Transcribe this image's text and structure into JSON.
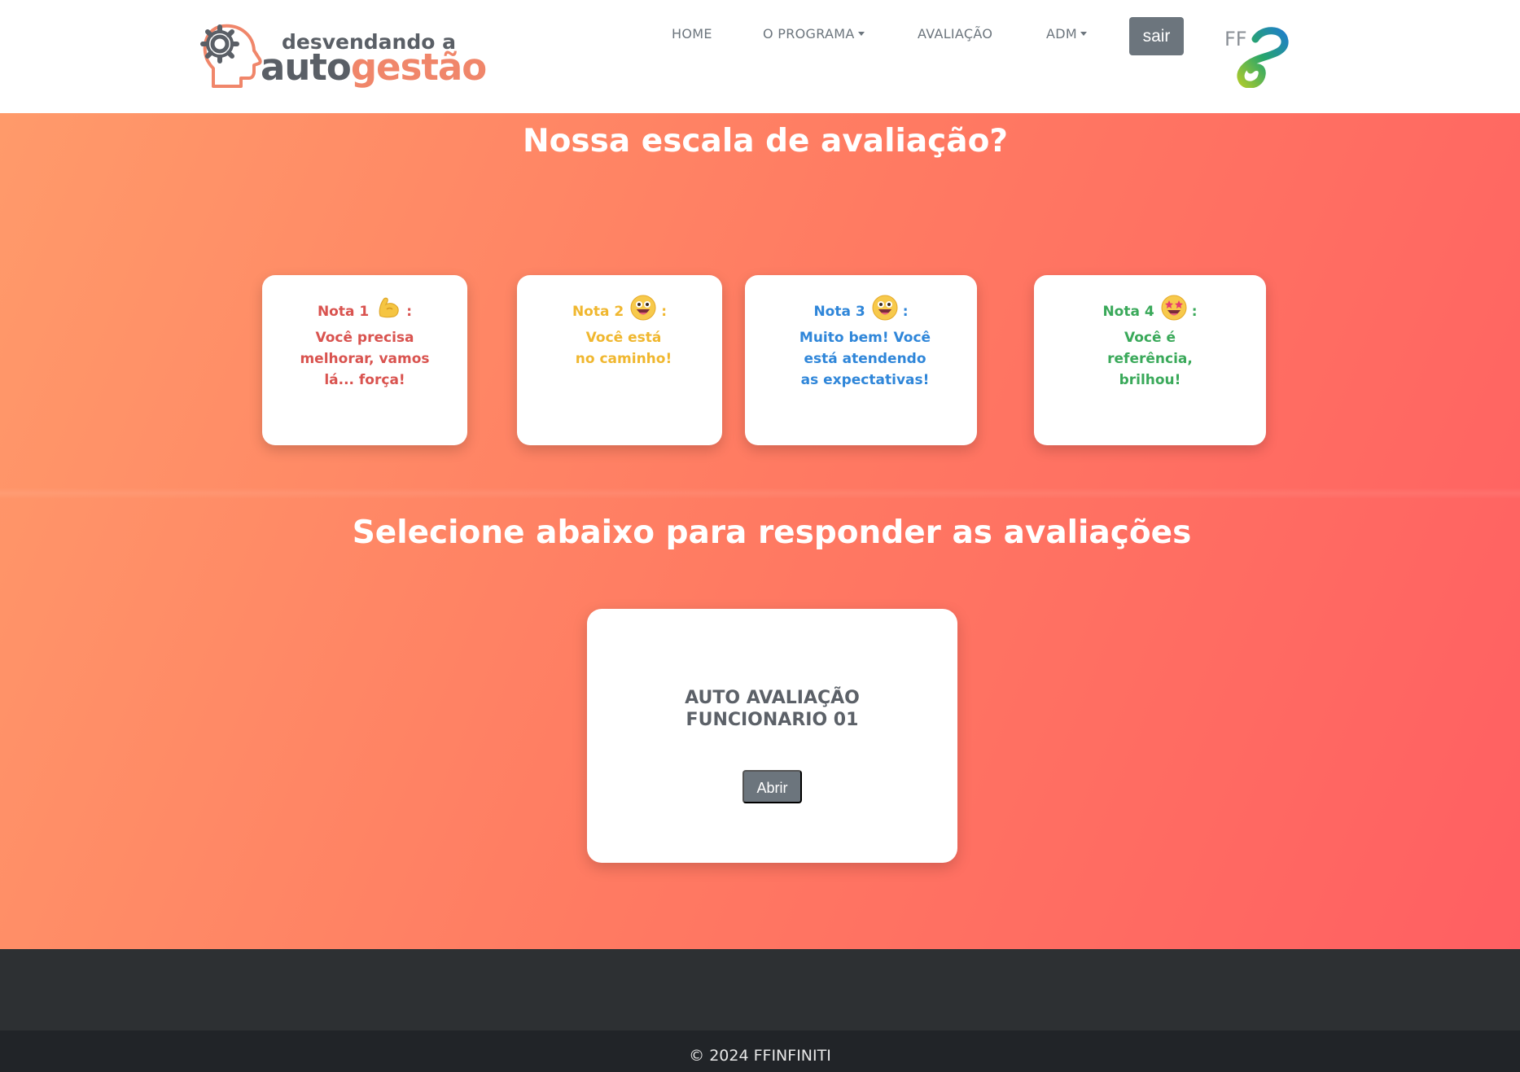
{
  "brand": {
    "line1": "desvendando a",
    "auto": "auto",
    "gestao": "gestão"
  },
  "nav": {
    "items": [
      "HOME",
      "O PROGRAMA",
      "AVALIAÇÃO",
      "ADM"
    ],
    "logout": "sair",
    "partner_logo_text": "FF"
  },
  "scale": {
    "heading": "Nossa escala de avaliação?",
    "cards": [
      {
        "label": "Nota 1",
        "icon": "flexed-biceps-icon",
        "sep": ":",
        "text": "Você precisa melhorar, vamos lá... força!",
        "color": "#d9534f"
      },
      {
        "label": "Nota 2",
        "icon": "smile-emoji-icon",
        "sep": ":",
        "text": "Você está no caminho!",
        "color": "#f0b72f"
      },
      {
        "label": "Nota 3",
        "icon": "smile-emoji-icon",
        "sep": ":",
        "text": "Muito bem! Você está atendendo as expectativas!",
        "color": "#2f86d9"
      },
      {
        "label": "Nota 4",
        "icon": "star-struck-emoji-icon",
        "sep": ":",
        "text": "Você é referência, brilhou!",
        "color": "#3aa95a"
      }
    ]
  },
  "evaluations": {
    "heading": "Selecione abaixo para responder as avaliações",
    "items": [
      {
        "title": "AUTO AVALIAÇÃO FUNCIONARIO 01",
        "button": "Abrir"
      }
    ]
  },
  "footer": {
    "copyright": "© 2024 FFINFINITI"
  },
  "colors": {
    "accent_orange": "#f0866a",
    "gradient_start": "#ff9a6a",
    "gradient_end": "#ff5f62",
    "button_gray": "#6c757d",
    "footer_dark": "#2d3033"
  }
}
